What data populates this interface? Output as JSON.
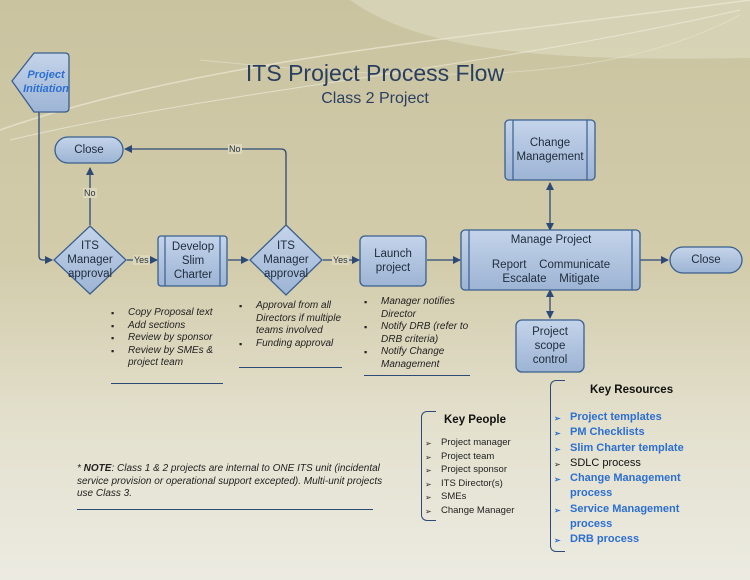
{
  "title": "ITS Project Process Flow",
  "subtitle": "Class 2 Project",
  "colors": {
    "node_fill": "#a9bfdc",
    "node_stroke": "#3a5f8f",
    "connector": "#2c4a75",
    "link_blue": "#2c6fd1",
    "title_text": "#2a3f5f"
  },
  "nodes": {
    "project_initiation": "Project Initiation",
    "close_top": "Close",
    "its_approval_1": "ITS Manager approval",
    "develop_slim_charter": "Develop Slim Charter",
    "its_approval_2": "ITS Manager approval",
    "launch_project": "Launch project",
    "manage_project": {
      "title": "Manage Project",
      "line1": "Report    Communicate",
      "line2": "Escalate    Mitigate"
    },
    "change_management": "Change Management",
    "project_scope_control": "Project scope control",
    "close_right": "Close"
  },
  "edge_labels": {
    "no_1": "No",
    "no_2": "No",
    "yes_1": "Yes",
    "yes_2": "Yes"
  },
  "notes": {
    "slim_charter": [
      "Copy Proposal text",
      "Add sections",
      "Review by sponsor",
      "Review by SMEs & project team"
    ],
    "approval": [
      "Approval from all Directors if multiple teams involved",
      "Funding approval"
    ],
    "launch": [
      "Manager notifies Director",
      "Notify DRB (refer to DRB criteria)",
      "Notify Change Management"
    ]
  },
  "key_people": {
    "heading": "Key People",
    "items": [
      "Project manager",
      "Project team",
      "Project sponsor",
      "ITS Director(s)",
      "SMEs",
      "Change Manager"
    ]
  },
  "key_resources": {
    "heading": "Key Resources",
    "items": [
      {
        "label": "Project templates",
        "link": true
      },
      {
        "label": "PM Checklists",
        "link": true
      },
      {
        "label": "Slim Charter template",
        "link": true
      },
      {
        "label": "SDLC process",
        "link": false
      },
      {
        "label": "Change Management process",
        "link": true
      },
      {
        "label": "Service Management process",
        "link": true
      },
      {
        "label": "DRB process",
        "link": true
      }
    ]
  },
  "footnote": {
    "prefix": "* ",
    "bold": "NOTE",
    "text": ": Class 1 & 2 projects are internal to ONE ITS unit (incidental service provision or operational support excepted). Multi-unit projects use Class 3."
  }
}
